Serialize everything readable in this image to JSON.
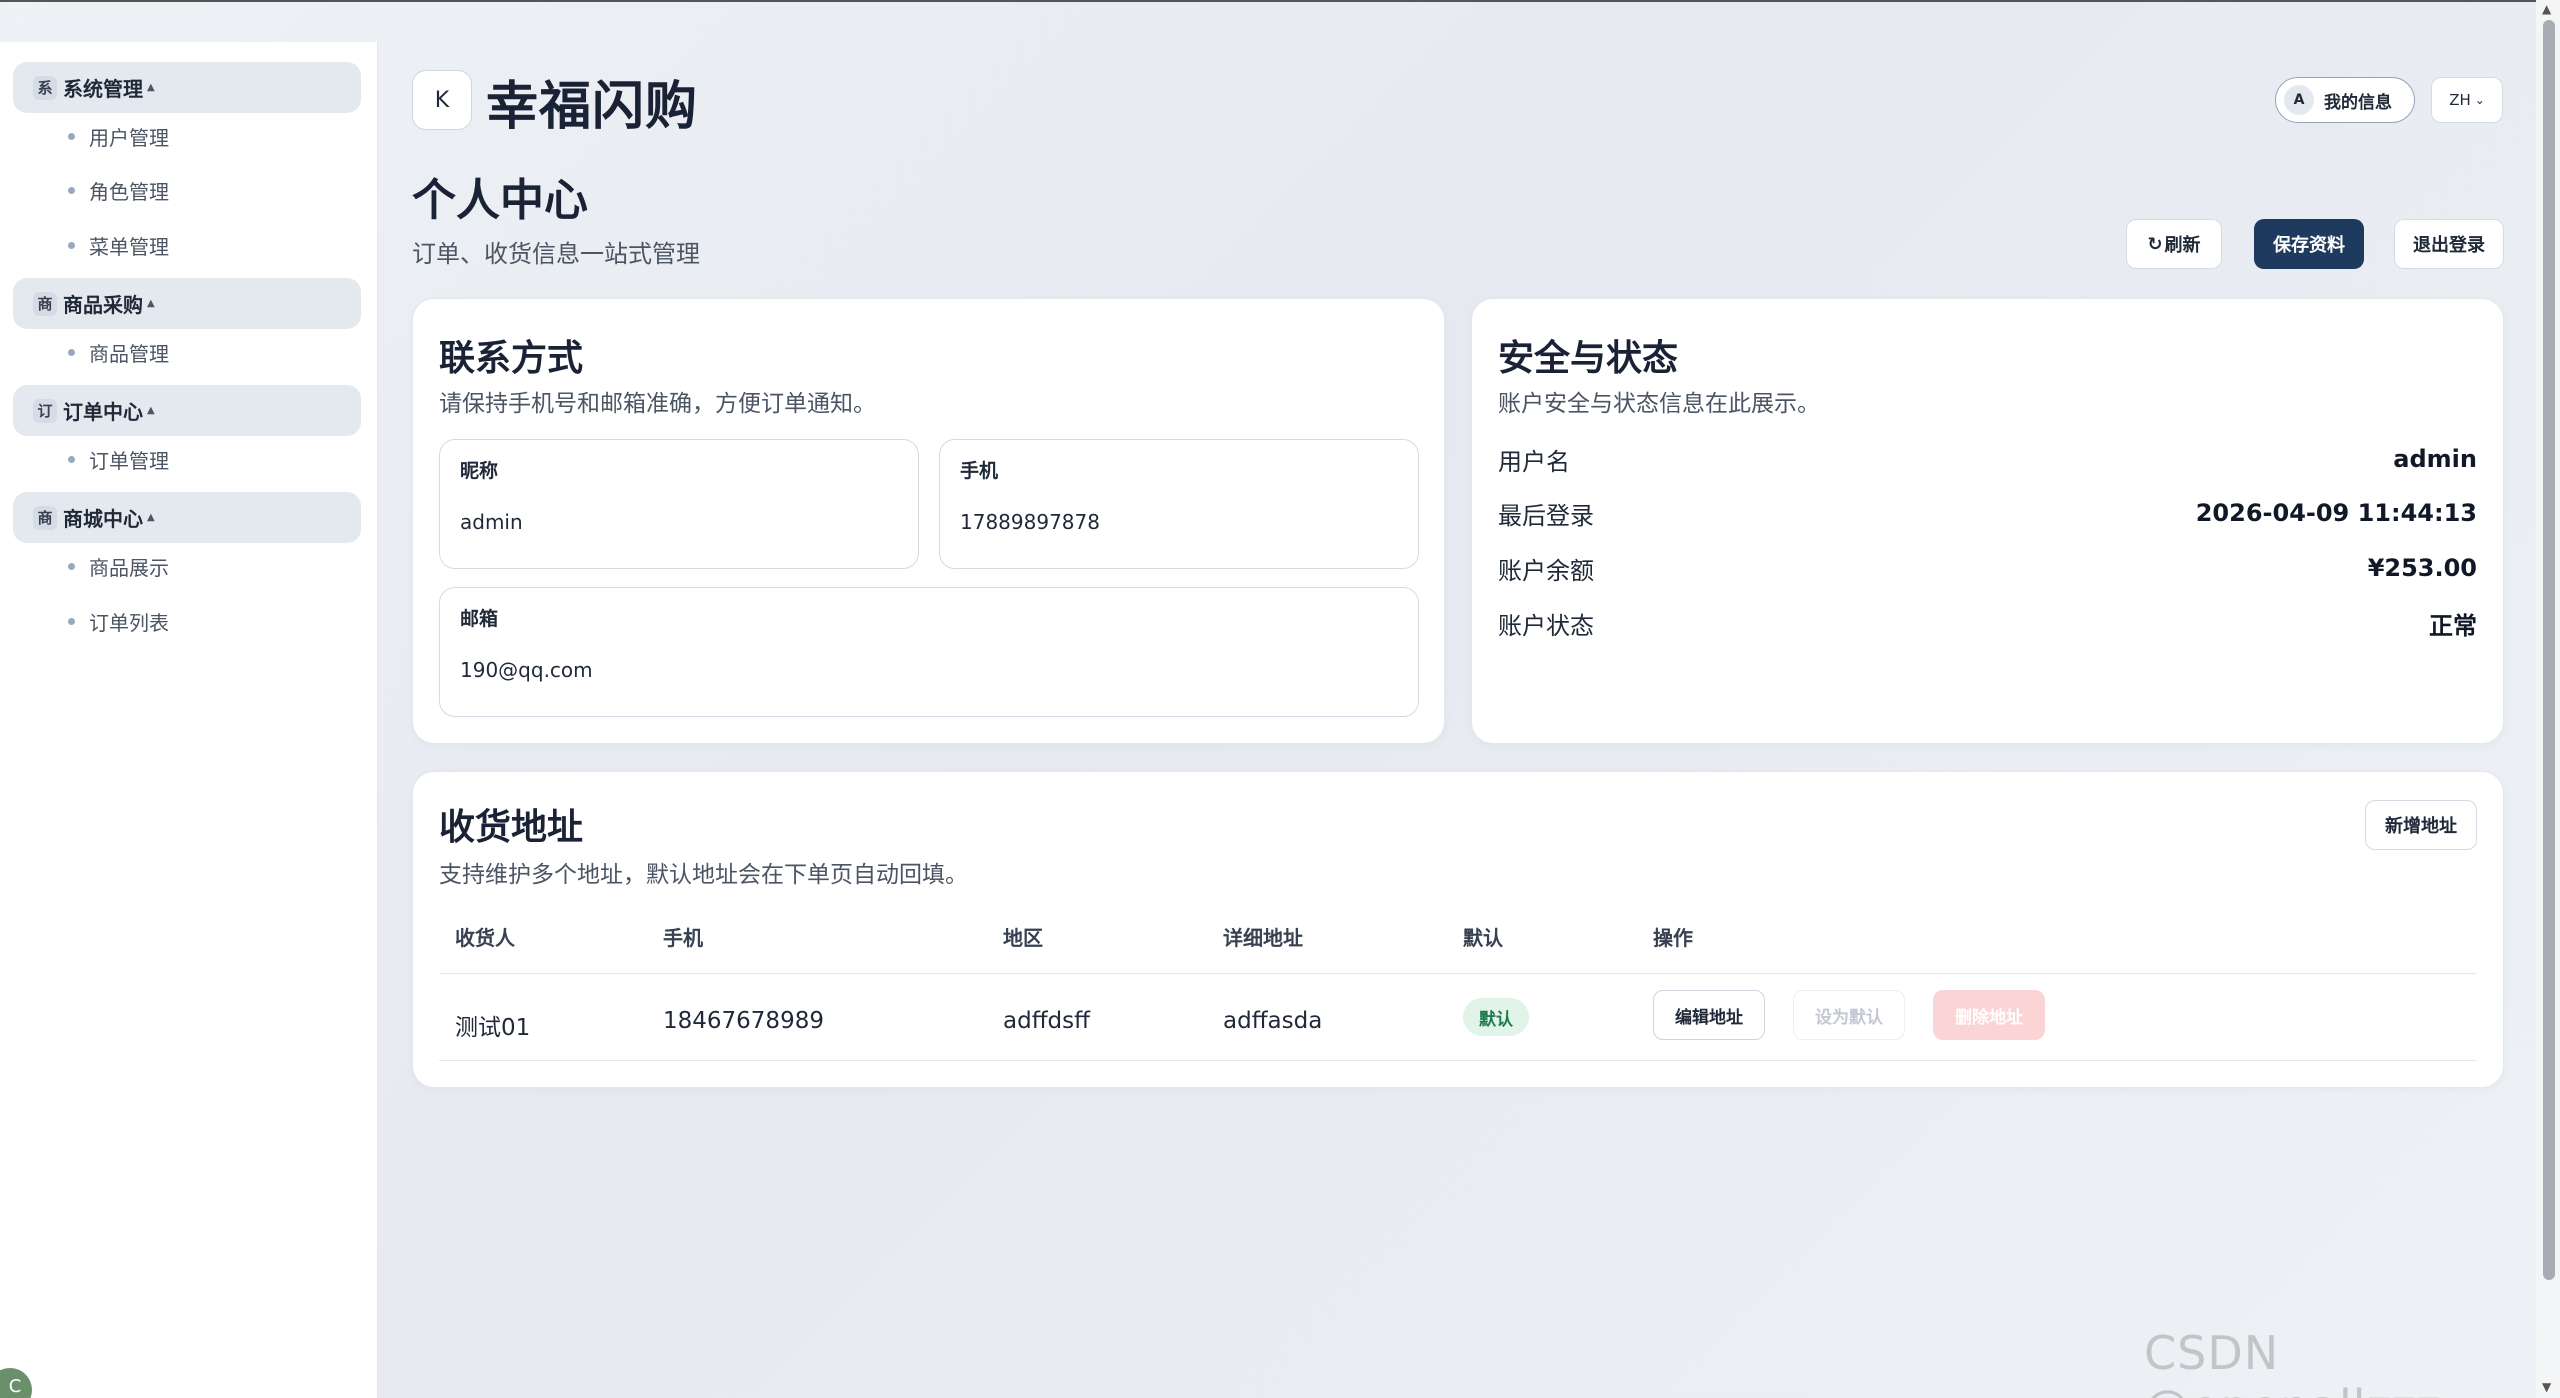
{
  "sidebar": {
    "groups": [
      {
        "icon": "系",
        "label": "系统管理",
        "items": [
          "用户管理",
          "角色管理",
          "菜单管理"
        ]
      },
      {
        "icon": "商",
        "label": "商品采购",
        "items": [
          "商品管理"
        ]
      },
      {
        "icon": "订",
        "label": "订单中心",
        "items": [
          "订单管理"
        ]
      },
      {
        "icon": "商",
        "label": "商城中心",
        "items": [
          "商品展示",
          "订单列表"
        ]
      }
    ],
    "corner_avatar": "C"
  },
  "header": {
    "logo_letter": "K",
    "brand": "幸福闪购",
    "user_avatar": "A",
    "user_label": "我的信息",
    "lang": "ZH"
  },
  "page": {
    "title": "个人中心",
    "subtitle": "订单、收货信息一站式管理",
    "actions": {
      "refresh": "刷新",
      "save": "保存资料",
      "logout": "退出登录"
    }
  },
  "contact": {
    "title": "联系方式",
    "subtitle": "请保持手机号和邮箱准确，方便订单通知。",
    "nickname_label": "昵称",
    "nickname": "admin",
    "phone_label": "手机",
    "phone": "17889897878",
    "email_label": "邮箱",
    "email": "190@qq.com"
  },
  "security": {
    "title": "安全与状态",
    "subtitle": "账户安全与状态信息在此展示。",
    "rows": [
      {
        "key": "用户名",
        "value": "admin"
      },
      {
        "key": "最后登录",
        "value": "2026-04-09 11:44:13"
      },
      {
        "key": "账户余额",
        "value": "¥253.00"
      },
      {
        "key": "账户状态",
        "value": "正常"
      }
    ]
  },
  "address": {
    "title": "收货地址",
    "subtitle": "支持维护多个地址，默认地址会在下单页自动回填。",
    "add_label": "新增地址",
    "columns": [
      "收货人",
      "手机",
      "地区",
      "详细地址",
      "默认",
      "操作"
    ],
    "rows": [
      {
        "receiver": "测试01",
        "phone": "18467678989",
        "region": "adffdsff",
        "detail": "adffasda",
        "default_badge": "默认",
        "edit": "编辑地址",
        "set_default": "设为默认",
        "delete": "删除地址"
      }
    ]
  },
  "watermark": "CSDN @openallzzz"
}
